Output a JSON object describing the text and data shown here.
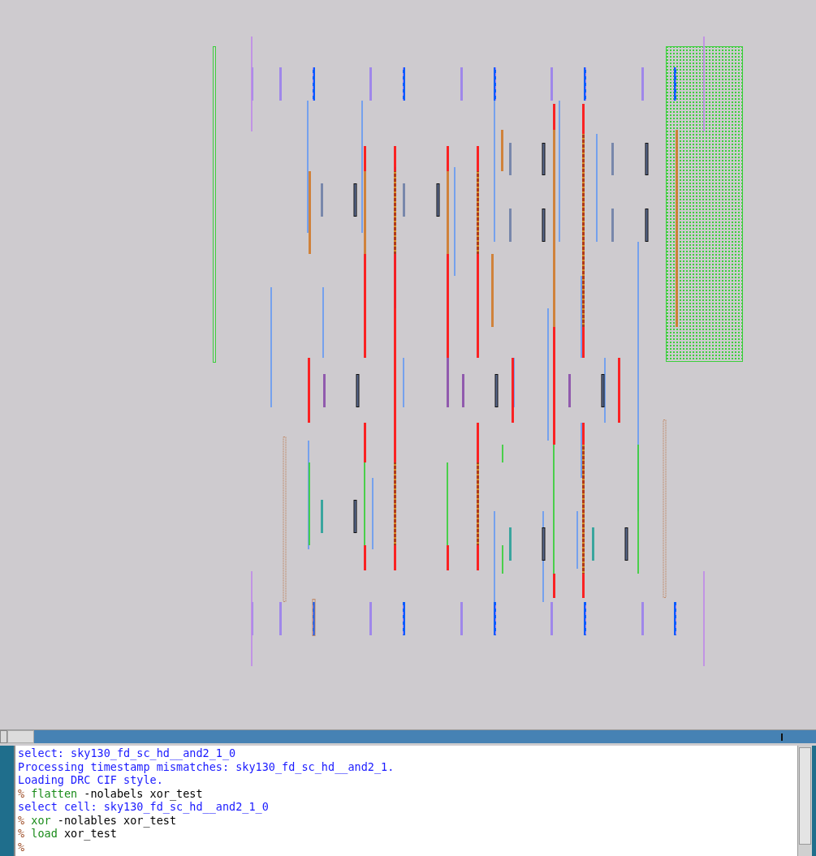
{
  "console": {
    "lines": [
      {
        "kind": "output",
        "text": "select: sky130_fd_sc_hd__and2_1_0"
      },
      {
        "kind": "output",
        "text": "Processing timestamp mismatches: sky130_fd_sc_hd__and2_1."
      },
      {
        "kind": "output",
        "text": "Loading DRC CIF style."
      },
      {
        "kind": "command",
        "prompt": "%",
        "command": "flatten",
        "args": "-nolabels xor_test"
      },
      {
        "kind": "output",
        "text": "select cell: sky130_fd_sc_hd__and2_1_0"
      },
      {
        "kind": "command",
        "prompt": "%",
        "command": "xor",
        "args": "-nolables xor_test"
      },
      {
        "kind": "command",
        "prompt": "%",
        "command": "load",
        "args": "xor_test"
      },
      {
        "kind": "prompt",
        "prompt": "%"
      }
    ]
  }
}
